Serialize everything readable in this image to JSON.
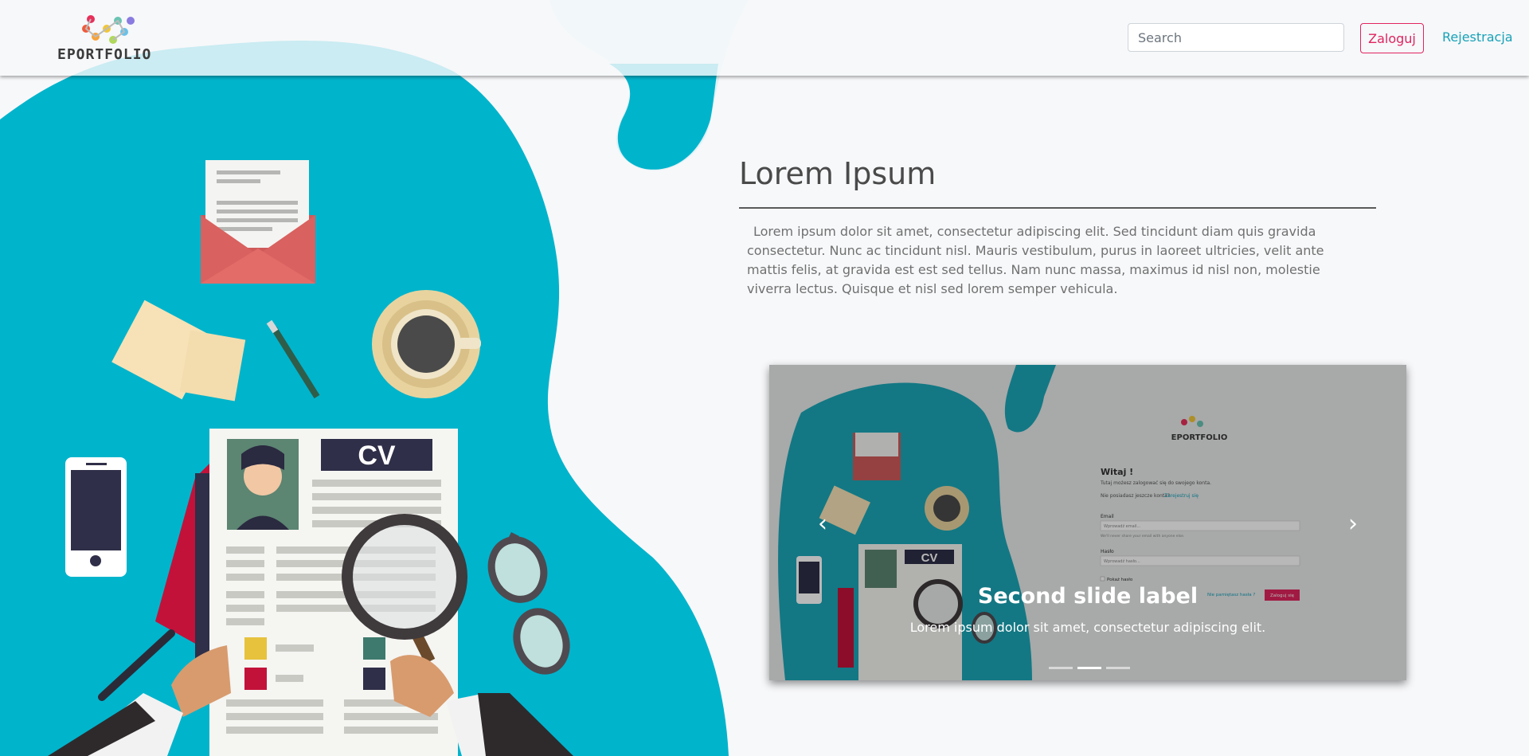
{
  "brand": {
    "name": "EPORTFOLIO"
  },
  "nav": {
    "search_placeholder": "Search",
    "login_label": "Zaloguj",
    "register_label": "Rejestracja"
  },
  "hero": {
    "title": "Lorem Ipsum",
    "text": "Lorem ipsum dolor sit amet, consectetur adipiscing elit. Sed tincidunt diam quis gravida consectetur. Nunc ac tincidunt nisl. Mauris vestibulum, purus in laoreet ultricies, velit ante mattis felis, at gravida est est sed tellus. Nam nunc massa, maximus id nisl non, molestie viverra lectus. Quisque et nisl sed lorem semper vehicula."
  },
  "illustration": {
    "cv_label": "CV"
  },
  "carousel": {
    "caption_title": "Second slide label",
    "caption_text": "Lorem ipsum dolor sit amet, consectetur adipiscing elit.",
    "slide_count": 3,
    "active_index": 1,
    "screenshot": {
      "brand": "EPORTFOLIO",
      "heading": "Witaj !",
      "subtitle": "Tutaj możesz zalogować się do swojego konta.",
      "no_account": "Nie posiadasz jeszcze konta?",
      "register_link": "Zarejestruj się",
      "email_label": "Email",
      "email_placeholder": "Wprowadź email...",
      "email_help": "We'll never share your email with anyone else.",
      "password_label": "Hasło",
      "password_placeholder": "Wprowadź hasło...",
      "show_password": "Pokaż hasło",
      "forgot_password": "Nie pamiętasz hasła ?",
      "login_button": "Zaloguj się",
      "cv_label": "CV"
    }
  },
  "colors": {
    "teal": "#00b4cc",
    "accent_pink": "#e0245e",
    "link_teal": "#17a2b8",
    "text_dark": "#4a4a4a"
  }
}
